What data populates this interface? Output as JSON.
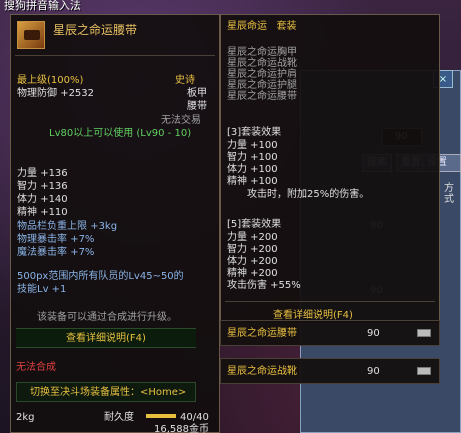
{
  "topbar": {
    "title": "搜狗拼音输入法"
  },
  "item": {
    "name": "星辰之命运腰带",
    "grade": "最上级",
    "grade_pct": "(100%)",
    "rarity": "史诗",
    "phys_def_label": "物理防御",
    "phys_def_value": "+2532",
    "type_a": "板甲",
    "type_b": "腰带",
    "trade": "无法交易",
    "level_req": "Lv80以上可以使用 (Lv90 - 10)",
    "stats": [
      {
        "label": "力量",
        "value": "+136"
      },
      {
        "label": "智力",
        "value": "+136"
      },
      {
        "label": "体力",
        "value": "+140"
      },
      {
        "label": "精神",
        "value": "+110"
      }
    ],
    "blue_stats": [
      {
        "label": "物品栏负重上限",
        "value": "+3kg"
      },
      {
        "label": "物理暴击率",
        "value": "+7%"
      },
      {
        "label": "魔法暴击率",
        "value": "+7%"
      }
    ],
    "skill_line1": "500px范围内所有队员的Lv45~50的",
    "skill_line2": "技能Lv +1",
    "upgrade_note": "该装备可以通过合成进行升级。",
    "detail_btn": "查看详细说明(F4)",
    "no_synth": "无法合成",
    "switch_label": "切换至决斗场装备属性：",
    "switch_key": "<Home>",
    "weight": "2kg",
    "durability_label": "耐久度",
    "durability_value": "40/40",
    "durability_fraction": 1.0,
    "price": "16,588金币"
  },
  "set": {
    "title": "星辰命运",
    "title_suffix": "套装",
    "pieces": [
      "星辰之命运胸甲",
      "星辰之命运战靴",
      "星辰之命运护肩",
      "星辰之命运护腿",
      "星辰之命运腰带"
    ],
    "effect3_title": "[3]套装效果",
    "effect3_stats": [
      "力量 +100",
      "智力 +100",
      "体力 +100",
      "精神 +100"
    ],
    "effect3_note": "攻击时，附加25%的伤害。",
    "effect5_title": "[5]套装效果",
    "effect5_stats": [
      "力量 +200",
      "智力 +200",
      "体力 +200",
      "精神 +200",
      "攻击伤害 +55%"
    ],
    "detail_btn": "查看详细说明(F4)",
    "rows": [
      {
        "name": "星辰之命运腰带",
        "level": "90"
      },
      {
        "name": "星辰之命运战靴",
        "level": "90"
      }
    ]
  },
  "window": {
    "close": "×",
    "input_value": "90",
    "search_btn": "搜索",
    "reset_btn": "重置",
    "settings_btn": "设置",
    "lv_a": "90",
    "lv_b": "90",
    "mode_label": "方式"
  }
}
